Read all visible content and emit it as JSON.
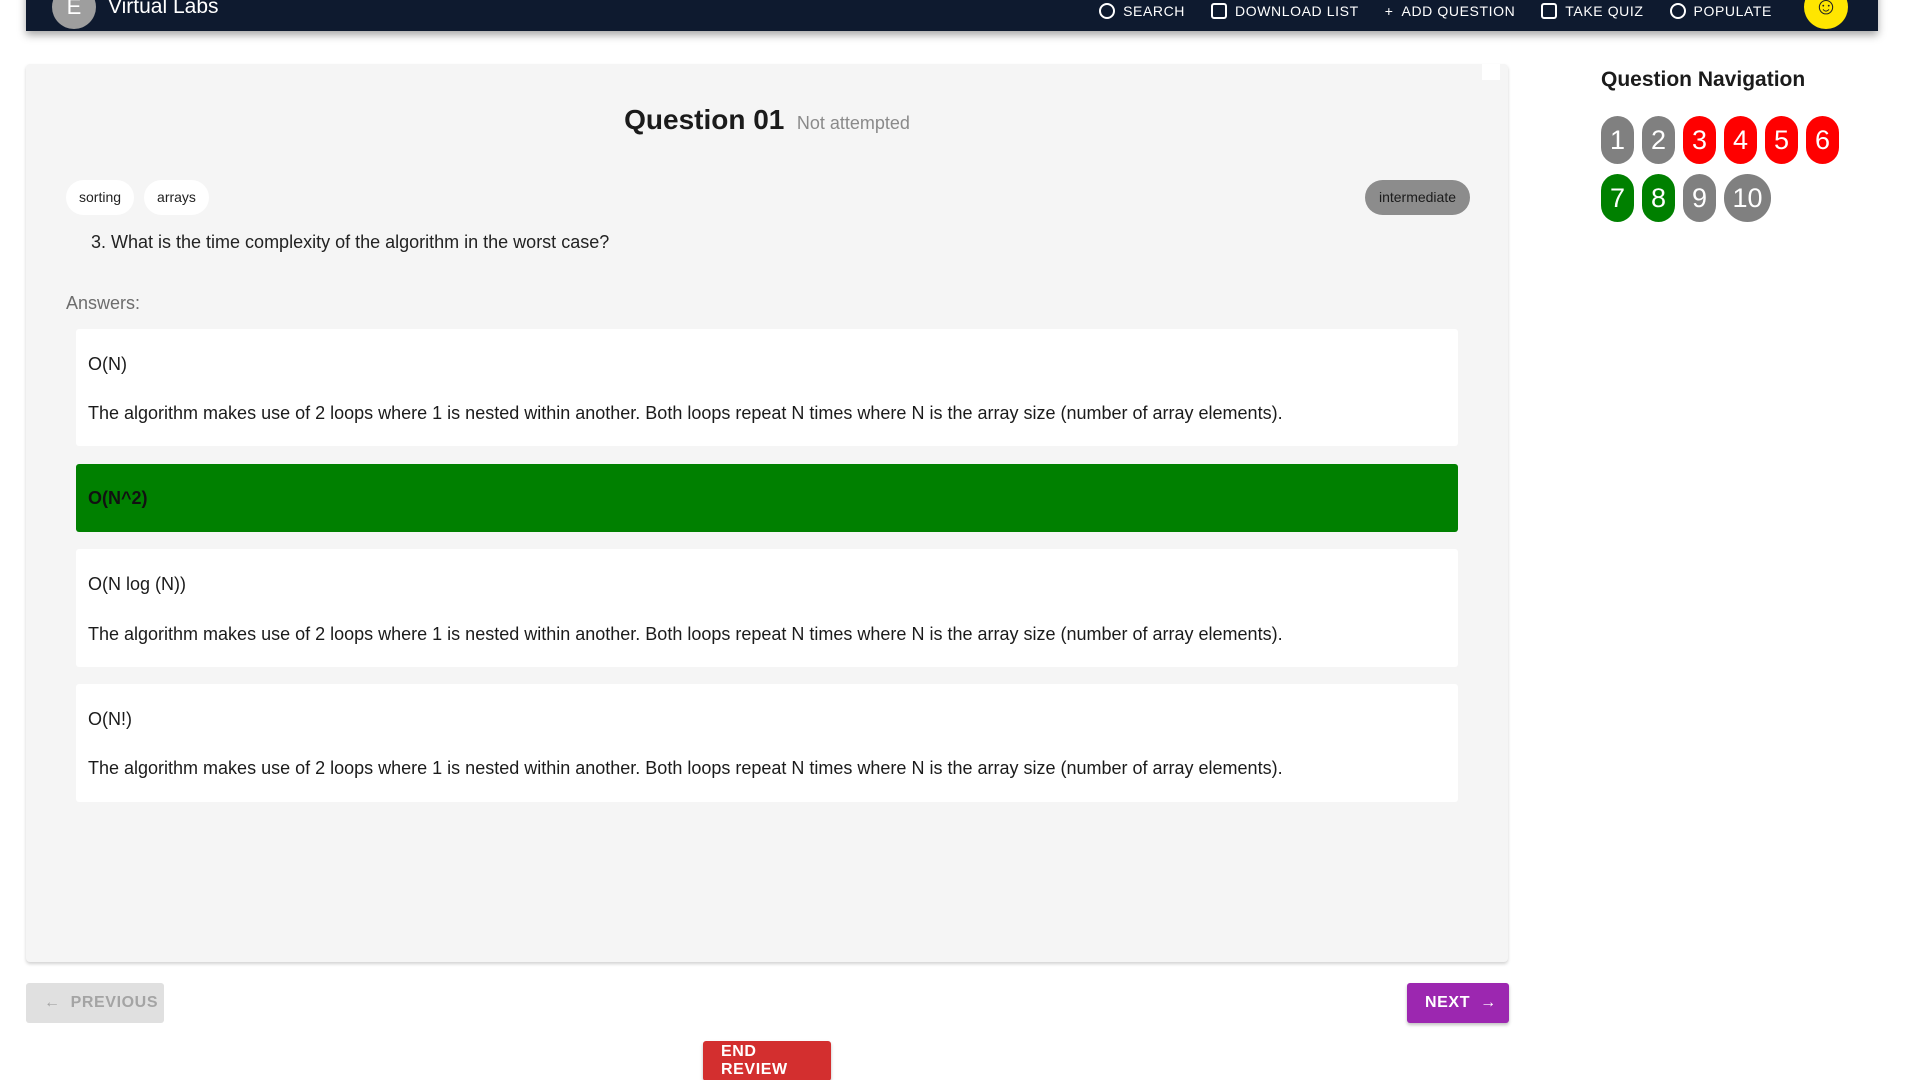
{
  "appbar": {
    "brand_initial": "E",
    "brand_name": "Virtual Labs",
    "actions": [
      "SEARCH",
      "DOWNLOAD LIST",
      "ADD QUESTION",
      "TAKE QUIZ",
      "POPULATE"
    ]
  },
  "question": {
    "title": "Question 01",
    "status": "Not attempted",
    "tags": [
      "sorting",
      "arrays"
    ],
    "difficulty": "intermediate",
    "text": "3. What is the time complexity of the algorithm in the worst case?",
    "answers_label": "Answers:",
    "answers": [
      {
        "option": "O(N)",
        "explanation": "The algorithm makes use of 2 loops where 1 is nested within another. Both loops repeat N times where N is the array size (number of array elements).",
        "state": "default"
      },
      {
        "option": "O(N^2)",
        "explanation": "",
        "state": "correct"
      },
      {
        "option": "O(N log (N))",
        "explanation": "The algorithm makes use of 2 loops where 1 is nested within another. Both loops repeat N times where N is the array size (number of array elements).",
        "state": "default"
      },
      {
        "option": "O(N!)",
        "explanation": "The algorithm makes use of 2 loops where 1 is nested within another. Both loops repeat N times where N is the array size (number of array elements).",
        "state": "default"
      }
    ],
    "correct_color": "#008000"
  },
  "buttons": {
    "previous": "PREVIOUS",
    "next": "NEXT",
    "end_review": "END REVIEW"
  },
  "navigation": {
    "title": "Question Navigation",
    "items": [
      {
        "label": "1",
        "status": "gray"
      },
      {
        "label": "2",
        "status": "gray"
      },
      {
        "label": "3",
        "status": "red"
      },
      {
        "label": "4",
        "status": "red"
      },
      {
        "label": "5",
        "status": "red"
      },
      {
        "label": "6",
        "status": "red"
      },
      {
        "label": "7",
        "status": "green"
      },
      {
        "label": "8",
        "status": "green"
      },
      {
        "label": "9",
        "status": "gray"
      },
      {
        "label": "10",
        "status": "gray"
      }
    ],
    "colors": {
      "gray": "#808080",
      "red": "#ff0000",
      "green": "#008000"
    }
  },
  "colors": {
    "appbar": "#0e1a2f",
    "next_button": "#9c27b0",
    "end_button": "#d32f2f"
  }
}
